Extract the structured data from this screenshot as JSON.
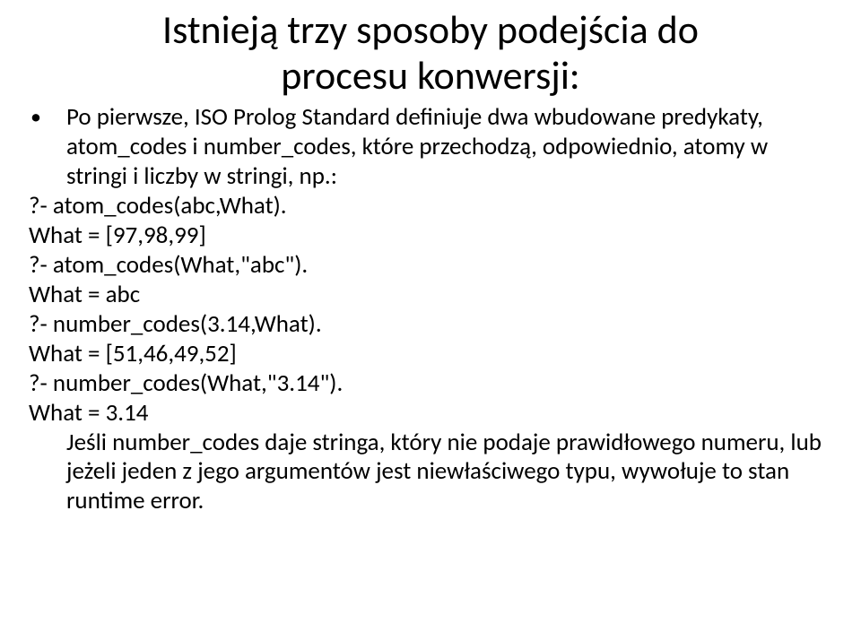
{
  "title_line1": "Istnieją trzy sposoby podejścia do",
  "title_line2": "procesu konwersji:",
  "bullet1_marker": "•",
  "bullet1_text": "Po pierwsze, ISO Prolog Standard definiuje dwa wbudowane predykaty, atom_codes i number_codes, które przechodzą, odpowiednio, atomy w stringi i liczby w stringi, np.:",
  "line1": "?- atom_codes(abc,What).",
  "line2": "What = [97,98,99]",
  "line3": "?- atom_codes(What,\"abc\").",
  "line4": "What = abc",
  "line5": "?- number_codes(3.14,What).",
  "line6": "What = [51,46,49,52]",
  "line7": "?- number_codes(What,\"3.14\").",
  "line8": "What = 3.14",
  "bullet2_text": "Jeśli number_codes daje stringa, który nie podaje prawidłowego numeru, lub jeżeli jeden z jego argumentów jest niewłaściwego typu, wywołuje to stan runtime error."
}
